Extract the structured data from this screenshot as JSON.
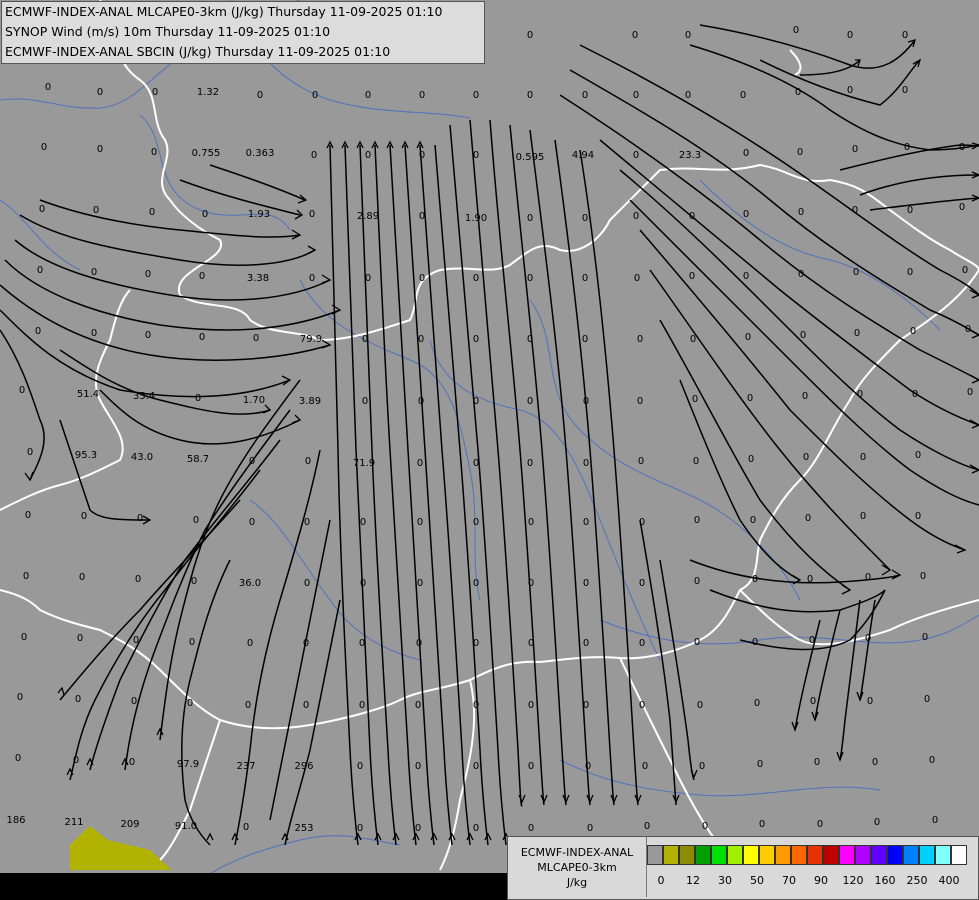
{
  "header": {
    "line1": "ECMWF-INDEX-ANAL MLCAPE0-3km (J/kg) Thursday 11-09-2025 01:10",
    "line2": "SYNOP Wind (m/s) 10m Thursday 11-09-2025 01:10",
    "line3": "ECMWF-INDEX-ANAL SBCIN (J/kg) Thursday 11-09-2025 01:10"
  },
  "legend": {
    "title_line1": "ECMWF-INDEX-ANAL",
    "title_line2": "MLCAPE0-3km",
    "unit": "J/kg",
    "colors": [
      "#999999",
      "#b2b200",
      "#8c8c00",
      "#00a000",
      "#00e000",
      "#a0f000",
      "#ffff00",
      "#ffcc00",
      "#ff9900",
      "#ff6600",
      "#e63200",
      "#c00000",
      "#ff00ff",
      "#b000ff",
      "#6000ff",
      "#0000ff",
      "#0080ff",
      "#00d0ff",
      "#80ffff",
      "#ffffff"
    ],
    "ticks": [
      "0",
      "12",
      "30",
      "50",
      "70",
      "90",
      "120",
      "160",
      "250",
      "400"
    ]
  },
  "field_values": [
    [
      "0",
      530,
      38
    ],
    [
      "0",
      635,
      38
    ],
    [
      "0",
      688,
      38
    ],
    [
      "0",
      796,
      33
    ],
    [
      "0",
      850,
      38
    ],
    [
      "0",
      905,
      38
    ],
    [
      "0",
      48,
      90
    ],
    [
      "0",
      100,
      95
    ],
    [
      "0",
      155,
      95
    ],
    [
      "1.32",
      208,
      95
    ],
    [
      "0",
      260,
      98
    ],
    [
      "0",
      315,
      98
    ],
    [
      "0",
      368,
      98
    ],
    [
      "0",
      422,
      98
    ],
    [
      "0",
      476,
      98
    ],
    [
      "0",
      530,
      98
    ],
    [
      "0",
      585,
      98
    ],
    [
      "0",
      636,
      98
    ],
    [
      "0",
      688,
      98
    ],
    [
      "0",
      743,
      98
    ],
    [
      "0",
      798,
      95
    ],
    [
      "0",
      850,
      93
    ],
    [
      "0",
      905,
      93
    ],
    [
      "0",
      44,
      150
    ],
    [
      "0",
      100,
      152
    ],
    [
      "0",
      154,
      155
    ],
    [
      "0.755",
      206,
      156
    ],
    [
      "0.363",
      260,
      156
    ],
    [
      "0",
      314,
      158
    ],
    [
      "0",
      368,
      158
    ],
    [
      "0",
      422,
      158
    ],
    [
      "0",
      476,
      158
    ],
    [
      "0.595",
      530,
      160
    ],
    [
      "4.94",
      583,
      158
    ],
    [
      "0",
      636,
      158
    ],
    [
      "23.3",
      690,
      158
    ],
    [
      "0",
      746,
      156
    ],
    [
      "0",
      800,
      155
    ],
    [
      "0",
      855,
      152
    ],
    [
      "0",
      907,
      150
    ],
    [
      "0",
      962,
      150
    ],
    [
      "0",
      42,
      212
    ],
    [
      "0",
      96,
      213
    ],
    [
      "0",
      152,
      215
    ],
    [
      "0",
      205,
      217
    ],
    [
      "1.93",
      259,
      217
    ],
    [
      "0",
      312,
      217
    ],
    [
      "2.89",
      368,
      219
    ],
    [
      "0",
      422,
      219
    ],
    [
      "1.90",
      476,
      221
    ],
    [
      "0",
      530,
      221
    ],
    [
      "0",
      585,
      221
    ],
    [
      "0",
      636,
      219
    ],
    [
      "0",
      692,
      219
    ],
    [
      "0",
      746,
      217
    ],
    [
      "0",
      801,
      215
    ],
    [
      "0",
      855,
      213
    ],
    [
      "0",
      910,
      213
    ],
    [
      "0",
      962,
      210
    ],
    [
      "0",
      40,
      273
    ],
    [
      "0",
      94,
      275
    ],
    [
      "0",
      148,
      277
    ],
    [
      "0",
      202,
      279
    ],
    [
      "3.38",
      258,
      281
    ],
    [
      "0",
      312,
      281
    ],
    [
      "0",
      368,
      281
    ],
    [
      "0",
      422,
      281
    ],
    [
      "0",
      476,
      281
    ],
    [
      "0",
      530,
      281
    ],
    [
      "0",
      585,
      281
    ],
    [
      "0",
      637,
      281
    ],
    [
      "0",
      692,
      279
    ],
    [
      "0",
      746,
      279
    ],
    [
      "0",
      801,
      277
    ],
    [
      "0",
      856,
      275
    ],
    [
      "0",
      910,
      275
    ],
    [
      "0",
      965,
      273
    ],
    [
      "0",
      38,
      334
    ],
    [
      "0",
      94,
      336
    ],
    [
      "0",
      148,
      338
    ],
    [
      "0",
      202,
      340
    ],
    [
      "0",
      256,
      341
    ],
    [
      "79.9",
      311,
      342
    ],
    [
      "0",
      365,
      342
    ],
    [
      "0",
      421,
      342
    ],
    [
      "0",
      476,
      342
    ],
    [
      "0",
      530,
      342
    ],
    [
      "0",
      585,
      342
    ],
    [
      "0",
      640,
      342
    ],
    [
      "0",
      693,
      342
    ],
    [
      "0",
      748,
      340
    ],
    [
      "0",
      803,
      338
    ],
    [
      "0",
      857,
      336
    ],
    [
      "0",
      913,
      334
    ],
    [
      "0",
      968,
      332
    ],
    [
      "0",
      22,
      393
    ],
    [
      "51.4",
      88,
      397
    ],
    [
      "33.4",
      144,
      399
    ],
    [
      "0",
      198,
      401
    ],
    [
      "1.70",
      254,
      403
    ],
    [
      "3.89",
      310,
      404
    ],
    [
      "0",
      365,
      404
    ],
    [
      "0",
      421,
      404
    ],
    [
      "0",
      476,
      404
    ],
    [
      "0",
      530,
      404
    ],
    [
      "0",
      586,
      404
    ],
    [
      "0",
      640,
      404
    ],
    [
      "0",
      695,
      402
    ],
    [
      "0",
      750,
      401
    ],
    [
      "0",
      805,
      399
    ],
    [
      "0",
      860,
      397
    ],
    [
      "0",
      915,
      397
    ],
    [
      "0",
      970,
      395
    ],
    [
      "0",
      30,
      455
    ],
    [
      "95.3",
      86,
      458
    ],
    [
      "43.0",
      142,
      460
    ],
    [
      "58.7",
      198,
      462
    ],
    [
      "0",
      252,
      464
    ],
    [
      "0",
      308,
      464
    ],
    [
      "71.9",
      364,
      466
    ],
    [
      "0",
      420,
      466
    ],
    [
      "0",
      476,
      466
    ],
    [
      "0",
      530,
      466
    ],
    [
      "0",
      586,
      466
    ],
    [
      "0",
      641,
      464
    ],
    [
      "0",
      696,
      464
    ],
    [
      "0",
      751,
      462
    ],
    [
      "0",
      806,
      460
    ],
    [
      "0",
      863,
      460
    ],
    [
      "0",
      918,
      458
    ],
    [
      "0",
      28,
      518
    ],
    [
      "0",
      84,
      519
    ],
    [
      "0",
      140,
      521
    ],
    [
      "0",
      196,
      523
    ],
    [
      "0",
      252,
      525
    ],
    [
      "0",
      307,
      525
    ],
    [
      "0",
      363,
      525
    ],
    [
      "0",
      420,
      525
    ],
    [
      "0",
      476,
      525
    ],
    [
      "0",
      531,
      525
    ],
    [
      "0",
      586,
      525
    ],
    [
      "0",
      642,
      525
    ],
    [
      "0",
      697,
      523
    ],
    [
      "0",
      753,
      523
    ],
    [
      "0",
      808,
      521
    ],
    [
      "0",
      863,
      519
    ],
    [
      "0",
      918,
      519
    ],
    [
      "0",
      26,
      579
    ],
    [
      "0",
      82,
      580
    ],
    [
      "0",
      138,
      582
    ],
    [
      "0",
      194,
      584
    ],
    [
      "36.0",
      250,
      586
    ],
    [
      "0",
      307,
      586
    ],
    [
      "0",
      363,
      586
    ],
    [
      "0",
      420,
      586
    ],
    [
      "0",
      476,
      586
    ],
    [
      "0",
      531,
      586
    ],
    [
      "0",
      586,
      586
    ],
    [
      "0",
      642,
      586
    ],
    [
      "0",
      697,
      584
    ],
    [
      "0",
      755,
      582
    ],
    [
      "0",
      810,
      582
    ],
    [
      "0",
      868,
      580
    ],
    [
      "0",
      923,
      579
    ],
    [
      "0",
      24,
      640
    ],
    [
      "0",
      80,
      641
    ],
    [
      "0",
      136,
      643
    ],
    [
      "0",
      192,
      645
    ],
    [
      "0",
      250,
      646
    ],
    [
      "0",
      306,
      646
    ],
    [
      "0",
      362,
      646
    ],
    [
      "0",
      419,
      646
    ],
    [
      "0",
      476,
      646
    ],
    [
      "0",
      531,
      646
    ],
    [
      "0",
      586,
      646
    ],
    [
      "0",
      642,
      646
    ],
    [
      "0",
      697,
      645
    ],
    [
      "0",
      755,
      645
    ],
    [
      "0",
      812,
      643
    ],
    [
      "0",
      868,
      641
    ],
    [
      "0",
      925,
      640
    ],
    [
      "0",
      20,
      700
    ],
    [
      "0",
      78,
      702
    ],
    [
      "0",
      134,
      704
    ],
    [
      "0",
      190,
      706
    ],
    [
      "0",
      248,
      708
    ],
    [
      "0",
      306,
      708
    ],
    [
      "0",
      362,
      708
    ],
    [
      "0",
      418,
      708
    ],
    [
      "0",
      476,
      708
    ],
    [
      "0",
      531,
      708
    ],
    [
      "0",
      586,
      708
    ],
    [
      "0",
      642,
      708
    ],
    [
      "0",
      700,
      708
    ],
    [
      "0",
      757,
      706
    ],
    [
      "0",
      813,
      704
    ],
    [
      "0",
      870,
      704
    ],
    [
      "0",
      927,
      702
    ],
    [
      "0",
      18,
      761
    ],
    [
      "0",
      76,
      763
    ],
    [
      "0",
      132,
      765
    ],
    [
      "97.9",
      188,
      767
    ],
    [
      "237",
      246,
      769
    ],
    [
      "296",
      304,
      769
    ],
    [
      "0",
      360,
      769
    ],
    [
      "0",
      418,
      769
    ],
    [
      "0",
      476,
      769
    ],
    [
      "0",
      531,
      769
    ],
    [
      "0",
      588,
      769
    ],
    [
      "0",
      645,
      769
    ],
    [
      "0",
      702,
      769
    ],
    [
      "0",
      760,
      767
    ],
    [
      "0",
      817,
      765
    ],
    [
      "0",
      875,
      765
    ],
    [
      "0",
      932,
      763
    ],
    [
      "186",
      16,
      823
    ],
    [
      "211",
      74,
      825
    ],
    [
      "209",
      130,
      827
    ],
    [
      "91.0",
      186,
      829
    ],
    [
      "0",
      246,
      830
    ],
    [
      "253",
      304,
      831
    ],
    [
      "0",
      360,
      831
    ],
    [
      "0",
      418,
      831
    ],
    [
      "0",
      476,
      831
    ],
    [
      "0",
      531,
      831
    ],
    [
      "0",
      590,
      831
    ],
    [
      "0",
      647,
      829
    ],
    [
      "0",
      705,
      829
    ],
    [
      "0",
      762,
      827
    ],
    [
      "0",
      820,
      827
    ],
    [
      "0",
      877,
      825
    ],
    [
      "0",
      935,
      823
    ]
  ]
}
